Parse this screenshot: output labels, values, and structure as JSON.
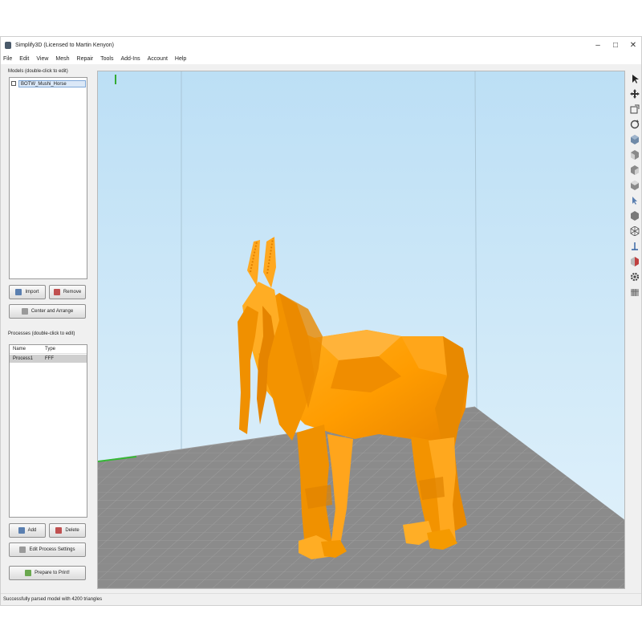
{
  "window": {
    "title": "Simplify3D (Licensed to Martin Kenyon)",
    "controls": {
      "minimize": "–",
      "maximize": "□",
      "close": "✕"
    }
  },
  "menu": [
    "File",
    "Edit",
    "View",
    "Mesh",
    "Repair",
    "Tools",
    "Add-Ins",
    "Account",
    "Help"
  ],
  "models": {
    "label": "Models (double-click to edit)",
    "items": [
      {
        "name": "BOTW_Mushi_Horse",
        "checked": true
      }
    ],
    "import_label": "Import",
    "remove_label": "Remove",
    "center_label": "Center and Arrange"
  },
  "processes": {
    "label": "Processes (double-click to edit)",
    "columns": [
      "Name",
      "Type"
    ],
    "rows": [
      {
        "name": "Process1",
        "type": "FFF"
      }
    ],
    "add_label": "Add",
    "delete_label": "Delete",
    "edit_label": "Edit Process Settings",
    "prepare_label": "Prepare to Print!"
  },
  "status": "Successfully parsed model with 4200 triangles",
  "toolbar": {
    "icons": [
      "select-icon",
      "move-icon",
      "zoom-icon",
      "rotate-icon",
      "default-view-icon",
      "front-view-icon",
      "side-view-icon",
      "top-view-icon",
      "cursor-mode-icon",
      "shaded-view-icon",
      "wireframe-icon",
      "axis-icon",
      "cross-section-icon",
      "settings-icon",
      "build-table-icon"
    ]
  },
  "colors": {
    "model": "#ffa500",
    "sky_top": "#bcdff5",
    "sky_bottom": "#dff1fb",
    "bed": "#8c8c8c",
    "accent_select": "#7fa8d8"
  }
}
